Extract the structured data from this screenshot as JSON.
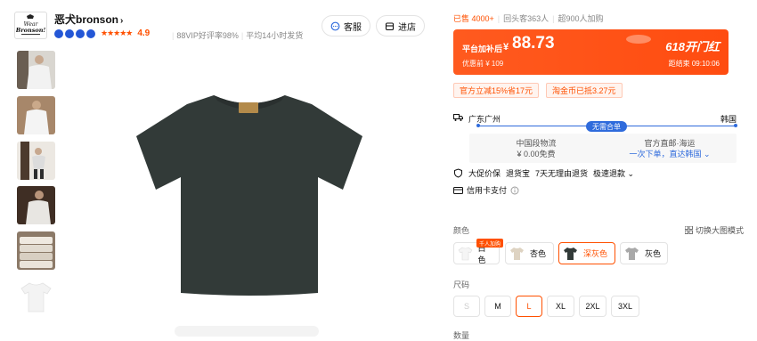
{
  "shop": {
    "logo_text": "Wear Bronson!",
    "name": "恶犬bronson",
    "chevron": "›",
    "stars": "★★★★★",
    "rating": "4.9",
    "vip": "88VIP好评率98%",
    "ship_time": "平均14小时发货",
    "service_label": "客服",
    "enter_label": "进店"
  },
  "stats": {
    "sold": "已售 4000+",
    "repeat": "回头客363人",
    "cart": "超900人加购"
  },
  "price": {
    "label": "平台加补后",
    "currency": "¥",
    "value": "88.73",
    "original": "优惠前 ¥ 109",
    "promo_title": "618开门红",
    "promo_end": "距结束 09:10:06"
  },
  "coupons": [
    "官方立减15%省17元",
    "淘金币已抵3.27元"
  ],
  "shipping": {
    "from": "广东广州",
    "to": "韩国",
    "tag": "无需合单",
    "left_title": "中国段物流",
    "left_value": "¥ 0.00免费",
    "right_title": "官方直邮·海运",
    "right_value": "一次下单，直达韩国 ⌄"
  },
  "guarantees": [
    "大促价保",
    "退货宝",
    "7天无理由退货",
    "极速退款 ⌄"
  ],
  "credit": "信用卡支付",
  "color_label": "颜色",
  "bigview_label": "切换大图模式",
  "hot_tag": "千人加购",
  "colors": [
    {
      "label": "白色"
    },
    {
      "label": "杏色"
    },
    {
      "label": "深灰色"
    },
    {
      "label": "灰色"
    }
  ],
  "size_label": "尺码",
  "sizes": [
    "S",
    "M",
    "L",
    "XL",
    "2XL",
    "3XL"
  ],
  "qty_label": "数量",
  "colors_hex": {
    "accent": "#ff5000",
    "blue": "#2f6bdc",
    "shirt": "#323a38"
  }
}
